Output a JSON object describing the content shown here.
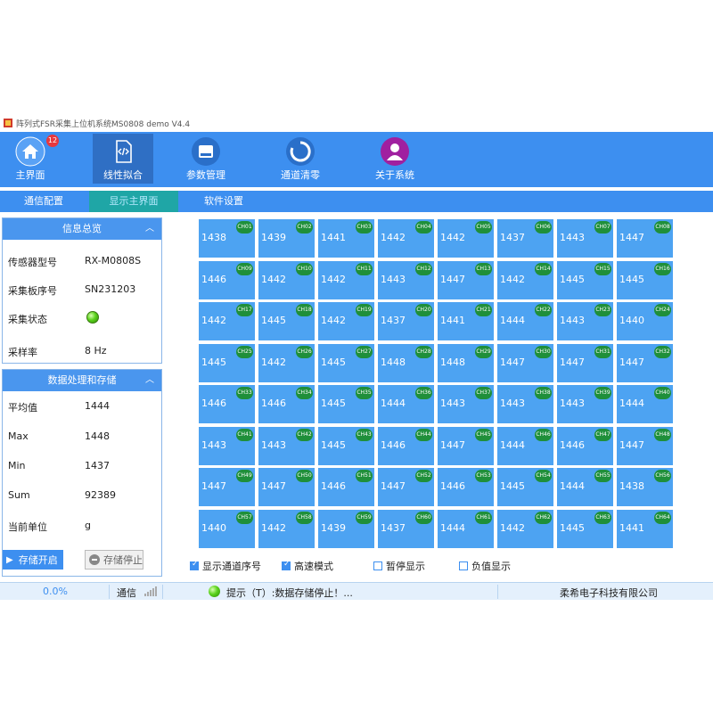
{
  "window": {
    "title": "阵列式FSR采集上位机系统MS0808 demo V4.4"
  },
  "toolbar": {
    "items": [
      {
        "label": "主界面",
        "icon": "home-icon",
        "badge": "12",
        "color": "#3d8ff0"
      },
      {
        "label": "线性拟合",
        "icon": "code-file-icon",
        "active": true,
        "color": "#2f6fc4"
      },
      {
        "label": "参数管理",
        "icon": "drive-icon",
        "color": "#3d8ff0"
      },
      {
        "label": "通道清零",
        "icon": "refresh-ring-icon",
        "color": "#3d8ff0"
      },
      {
        "label": "关于系统",
        "icon": "user-icon",
        "color": "#a020a0"
      }
    ]
  },
  "tabs": [
    {
      "label": "通信配置"
    },
    {
      "label": "显示主界面",
      "active": true
    },
    {
      "label": "软件设置"
    }
  ],
  "info_panel": {
    "title": "信息总览",
    "rows": [
      {
        "label": "传感器型号",
        "value": "RX-M0808S"
      },
      {
        "label": "采集板序号",
        "value": "SN231203"
      },
      {
        "label": "采集状态",
        "value": ""
      },
      {
        "label": "采样率",
        "value": "8 Hz"
      }
    ]
  },
  "data_panel": {
    "title": "数据处理和存储",
    "rows": [
      {
        "label": "平均值",
        "value": "1444"
      },
      {
        "label": "Max",
        "value": "1448"
      },
      {
        "label": "Min",
        "value": "1437"
      },
      {
        "label": "Sum",
        "value": "92389"
      },
      {
        "label": "当前单位",
        "value": "g"
      }
    ],
    "start_button": "存储开启",
    "stop_button": "存储停止"
  },
  "channels": [
    1438,
    1439,
    1441,
    1442,
    1442,
    1437,
    1443,
    1447,
    1446,
    1442,
    1442,
    1443,
    1447,
    1442,
    1445,
    1445,
    1442,
    1445,
    1442,
    1437,
    1441,
    1444,
    1443,
    1440,
    1445,
    1442,
    1445,
    1448,
    1448,
    1447,
    1447,
    1447,
    1446,
    1446,
    1445,
    1444,
    1443,
    1443,
    1443,
    1444,
    1443,
    1443,
    1445,
    1446,
    1447,
    1444,
    1446,
    1447,
    1447,
    1447,
    1446,
    1447,
    1446,
    1445,
    1444,
    1438,
    1440,
    1442,
    1439,
    1437,
    1444,
    1442,
    1445,
    1441
  ],
  "channel_prefix": "CH",
  "options": [
    {
      "label": "显示通道序号",
      "checked": true
    },
    {
      "label": "高速模式",
      "checked": true
    },
    {
      "label": "暂停显示",
      "checked": false
    },
    {
      "label": "负值显示",
      "checked": false
    }
  ],
  "statusbar": {
    "progress": "0.0%",
    "comm_label": "通信",
    "tip": "提示（T）:数据存储停止！...",
    "company": "柔希电子科技有限公司"
  }
}
